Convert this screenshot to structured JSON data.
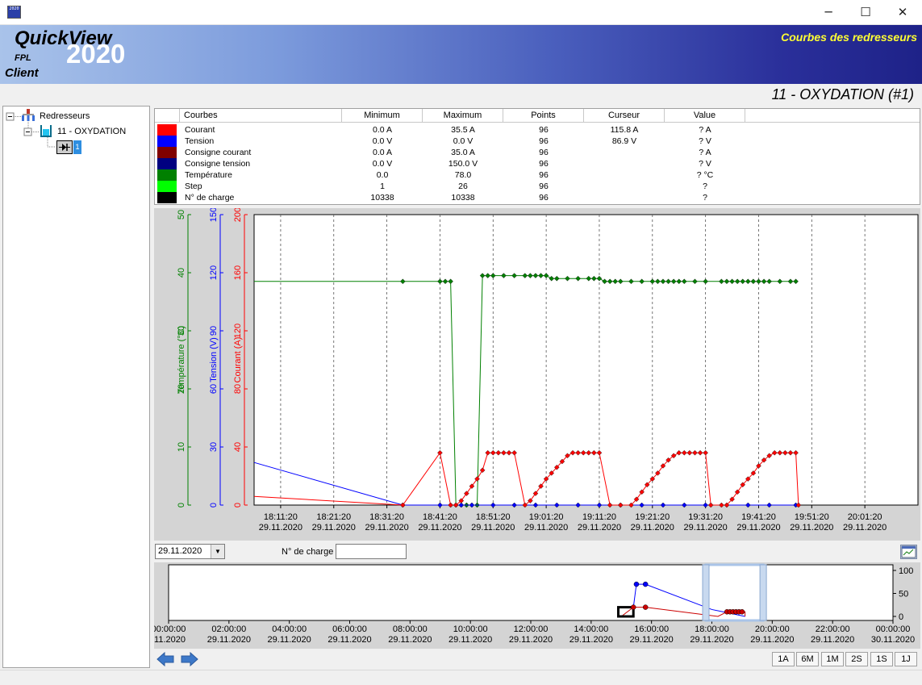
{
  "window": {
    "icon_label": "2020",
    "minimize_label": "─",
    "maximize_label": "☐",
    "close_label": "✕"
  },
  "banner": {
    "brand": "QuickView",
    "year": "2020",
    "fpl": "FPL",
    "client": "Client",
    "screen_title": "Courbes des redresseurs"
  },
  "plant_title": "11 - OXYDATION (#1)",
  "tree": {
    "root": "Redresseurs",
    "child": "11 - OXYDATION",
    "leaf_badge": "1"
  },
  "legend": {
    "headers": [
      "Courbes",
      "Minimum",
      "Maximum",
      "Points",
      "Curseur",
      "Value"
    ],
    "rows": [
      {
        "name": "Courant",
        "color": "#ff0000",
        "min": "0.0 A",
        "max": "35.5 A",
        "points": "96",
        "cursor": "115.8 A",
        "value": "? A"
      },
      {
        "name": "Tension",
        "color": "#0000ff",
        "min": "0.0 V",
        "max": "0.0 V",
        "points": "96",
        "cursor": "86.9 V",
        "value": "? V"
      },
      {
        "name": "Consigne courant",
        "color": "#800000",
        "min": "0.0 A",
        "max": "35.0 A",
        "points": "96",
        "cursor": "",
        "value": "? A"
      },
      {
        "name": "Consigne tension",
        "color": "#000080",
        "min": "0.0 V",
        "max": "150.0 V",
        "points": "96",
        "cursor": "",
        "value": "? V"
      },
      {
        "name": "Température",
        "color": "#008000",
        "min": "0.0",
        "max": "78.0",
        "points": "96",
        "cursor": "",
        "value": "? °C"
      },
      {
        "name": "Step",
        "color": "#00ff00",
        "min": "1",
        "max": "26",
        "points": "96",
        "cursor": "",
        "value": "?"
      },
      {
        "name": "N° de charge",
        "color": "#000000",
        "min": "10338",
        "max": "10338",
        "points": "96",
        "cursor": "",
        "value": "?"
      }
    ]
  },
  "chart_data": {
    "type": "line",
    "axes": [
      {
        "label": "Température (°C)",
        "color": "#008000",
        "ylim": [
          0,
          50
        ],
        "ticks": [
          "0",
          "10",
          "20",
          "30",
          "40",
          "50"
        ]
      },
      {
        "label": "Tension (V)",
        "color": "#0000ff",
        "ylim": [
          0,
          150
        ],
        "ticks": [
          "0",
          "30",
          "60",
          "90",
          "120",
          "150"
        ]
      },
      {
        "label": "Courant (A)",
        "color": "#ff0000",
        "ylim": [
          0,
          200
        ],
        "ticks": [
          "0",
          "40",
          "80",
          "120",
          "160",
          "200"
        ]
      }
    ],
    "x_ticks": [
      {
        "time": "18:11:20",
        "date": "29.11.2020"
      },
      {
        "time": "18:21:20",
        "date": "29.11.2020"
      },
      {
        "time": "18:31:20",
        "date": "29.11.2020"
      },
      {
        "time": "18:41:20",
        "date": "29.11.2020"
      },
      {
        "time": "18:51:20",
        "date": "29.11.2020"
      },
      {
        "time": "19:01:20",
        "date": "29.11.2020"
      },
      {
        "time": "19:11:20",
        "date": "29.11.2020"
      },
      {
        "time": "19:21:20",
        "date": "29.11.2020"
      },
      {
        "time": "19:31:20",
        "date": "29.11.2020"
      },
      {
        "time": "19:41:20",
        "date": "29.11.2020"
      },
      {
        "time": "19:51:20",
        "date": "29.11.2020"
      },
      {
        "time": "20:01:20",
        "date": "29.11.2020"
      }
    ],
    "xlim_minutes": [
      -5,
      120
    ],
    "grid": "vertical dashed",
    "series": [
      {
        "name": "Température",
        "color": "#008000",
        "axis": 0,
        "points": [
          [
            -5,
            38.5
          ],
          [
            23,
            38.5
          ],
          [
            30,
            38.5
          ],
          [
            31,
            38.5
          ],
          [
            32,
            38.5
          ],
          [
            33,
            0
          ],
          [
            34,
            0
          ],
          [
            35,
            0
          ],
          [
            36,
            0
          ],
          [
            37,
            0
          ],
          [
            38,
            39.5
          ],
          [
            39,
            39.5
          ],
          [
            40,
            39.5
          ],
          [
            42,
            39.5
          ],
          [
            44,
            39.5
          ],
          [
            46,
            39.5
          ],
          [
            47,
            39.5
          ],
          [
            48,
            39.5
          ],
          [
            49,
            39.5
          ],
          [
            50,
            39.5
          ],
          [
            51,
            39
          ],
          [
            52,
            39
          ],
          [
            54,
            39
          ],
          [
            56,
            39
          ],
          [
            58,
            39
          ],
          [
            59,
            39
          ],
          [
            60,
            39
          ],
          [
            61,
            38.5
          ],
          [
            62,
            38.5
          ],
          [
            63,
            38.5
          ],
          [
            64,
            38.5
          ],
          [
            66,
            38.5
          ],
          [
            68,
            38.5
          ],
          [
            70,
            38.5
          ],
          [
            71,
            38.5
          ],
          [
            72,
            38.5
          ],
          [
            73,
            38.5
          ],
          [
            74,
            38.5
          ],
          [
            75,
            38.5
          ],
          [
            76,
            38.5
          ],
          [
            78,
            38.5
          ],
          [
            80,
            38.5
          ],
          [
            83,
            38.5
          ],
          [
            84,
            38.5
          ],
          [
            85,
            38.5
          ],
          [
            86,
            38.5
          ],
          [
            87,
            38.5
          ],
          [
            88,
            38.5
          ],
          [
            89,
            38.5
          ],
          [
            90,
            38.5
          ],
          [
            91,
            38.5
          ],
          [
            92,
            38.5
          ],
          [
            94,
            38.5
          ],
          [
            96,
            38.5
          ],
          [
            97,
            38.5
          ]
        ]
      },
      {
        "name": "Tension",
        "color": "#0000ff",
        "axis": 1,
        "points": [
          [
            -5,
            22
          ],
          [
            23,
            0
          ],
          [
            30,
            0
          ],
          [
            32,
            0
          ],
          [
            34,
            0
          ],
          [
            36,
            0
          ],
          [
            40,
            0
          ],
          [
            44,
            0
          ],
          [
            48,
            0
          ],
          [
            52,
            0
          ],
          [
            56,
            0
          ],
          [
            60,
            0
          ],
          [
            64,
            0
          ],
          [
            68,
            0
          ],
          [
            72,
            0
          ],
          [
            76,
            0
          ],
          [
            80,
            0
          ],
          [
            84,
            0
          ],
          [
            88,
            0
          ],
          [
            92,
            0
          ],
          [
            97,
            0
          ]
        ]
      },
      {
        "name": "Courant",
        "color": "#ff0000",
        "axis": 2,
        "points": [
          [
            -5,
            6
          ],
          [
            23,
            0
          ],
          [
            30,
            36
          ],
          [
            32,
            0
          ],
          [
            33,
            0
          ],
          [
            34,
            3
          ],
          [
            35,
            8
          ],
          [
            36,
            13
          ],
          [
            37,
            18
          ],
          [
            38,
            24
          ],
          [
            39,
            36
          ],
          [
            40,
            36
          ],
          [
            41,
            36
          ],
          [
            42,
            36
          ],
          [
            43,
            36
          ],
          [
            44,
            36
          ],
          [
            46,
            0
          ],
          [
            47,
            3
          ],
          [
            48,
            8
          ],
          [
            49,
            13
          ],
          [
            50,
            18
          ],
          [
            51,
            22
          ],
          [
            52,
            26
          ],
          [
            53,
            30
          ],
          [
            54,
            34
          ],
          [
            55,
            36
          ],
          [
            56,
            36
          ],
          [
            57,
            36
          ],
          [
            58,
            36
          ],
          [
            59,
            36
          ],
          [
            60,
            36
          ],
          [
            62,
            0
          ],
          [
            64,
            0
          ],
          [
            66,
            0
          ],
          [
            67,
            4
          ],
          [
            68,
            9
          ],
          [
            69,
            14
          ],
          [
            70,
            18
          ],
          [
            71,
            22
          ],
          [
            72,
            27
          ],
          [
            73,
            31
          ],
          [
            74,
            34
          ],
          [
            75,
            36
          ],
          [
            76,
            36
          ],
          [
            77,
            36
          ],
          [
            78,
            36
          ],
          [
            79,
            36
          ],
          [
            80,
            36
          ],
          [
            81,
            0
          ],
          [
            83,
            0
          ],
          [
            84,
            0
          ],
          [
            85,
            4
          ],
          [
            86,
            9
          ],
          [
            87,
            14
          ],
          [
            88,
            18
          ],
          [
            89,
            22
          ],
          [
            90,
            27
          ],
          [
            91,
            31
          ],
          [
            92,
            34
          ],
          [
            93,
            36
          ],
          [
            94,
            36
          ],
          [
            95,
            36
          ],
          [
            96,
            36
          ],
          [
            97,
            36
          ],
          [
            97.5,
            0
          ]
        ]
      }
    ]
  },
  "date_selector": {
    "value": "29.11.2020",
    "arrow": "▼"
  },
  "charge": {
    "label": "N° de charge",
    "value": ""
  },
  "overview": {
    "y_ticks": [
      "0",
      "50",
      "100"
    ],
    "x_ticks": [
      {
        "time": "00:00:00",
        "date": ".11.2020"
      },
      {
        "time": "02:00:00",
        "date": "29.11.2020"
      },
      {
        "time": "04:00:00",
        "date": "29.11.2020"
      },
      {
        "time": "06:00:00",
        "date": "29.11.2020"
      },
      {
        "time": "08:00:00",
        "date": "29.11.2020"
      },
      {
        "time": "10:00:00",
        "date": "29.11.2020"
      },
      {
        "time": "12:00:00",
        "date": "29.11.2020"
      },
      {
        "time": "14:00:00",
        "date": "29.11.2020"
      },
      {
        "time": "16:00:00",
        "date": "29.11.2020"
      },
      {
        "time": "18:00:00",
        "date": "29.11.2020"
      },
      {
        "time": "20:00:00",
        "date": "29.11.2020"
      },
      {
        "time": "22:00:00",
        "date": "29.11.2020"
      },
      {
        "time": "00:00:00",
        "date": "30.11.2020"
      }
    ],
    "selection_hours": [
      17.8,
      19.7
    ]
  },
  "range_buttons": [
    "1A",
    "6M",
    "1M",
    "2S",
    "1S",
    "1J"
  ]
}
